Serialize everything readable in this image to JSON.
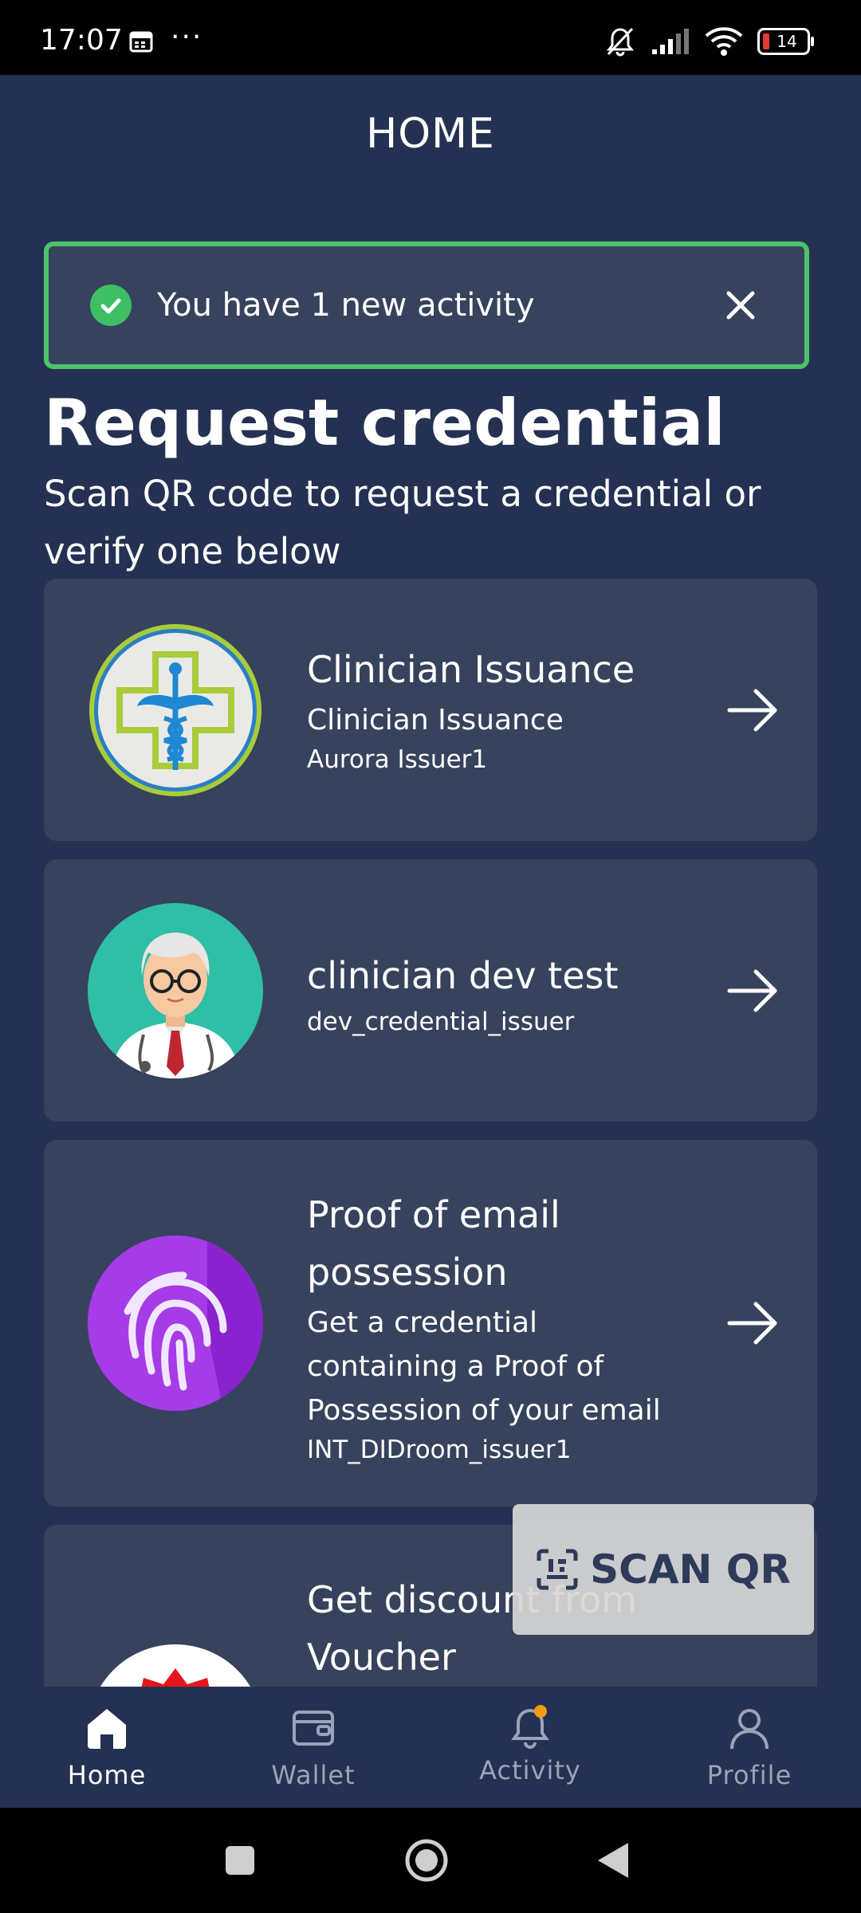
{
  "status_bar": {
    "time": "17:07",
    "overflow": "···",
    "battery_level": "14",
    "icons": [
      "calendar-icon",
      "mute-icon",
      "signal-icon",
      "wifi-icon",
      "battery-icon"
    ]
  },
  "header": {
    "title": "HOME"
  },
  "notification": {
    "text": "You have 1 new activity",
    "accent_color": "#4cc36a"
  },
  "section": {
    "title": "Request credential",
    "subtitle": "Scan QR code to request a credential or verify one below"
  },
  "credentials": [
    {
      "title": "Clinician Issuance",
      "subtitle": "Clinician Issuance",
      "issuer": "Aurora Issuer1",
      "icon": "medical-caduceus-icon"
    },
    {
      "title": "clinician dev test",
      "subtitle": "",
      "issuer": "dev_credential_issuer",
      "icon": "doctor-avatar-icon"
    },
    {
      "title": "Proof of email possession",
      "subtitle": "Get a credential containing a Proof of Possession of your email",
      "issuer": "INT_DIDroom_issuer1",
      "icon": "fingerprint-icon"
    },
    {
      "title": "Get discount from Voucher",
      "subtitle": "",
      "issuer": "",
      "icon": "voucher-badge-icon"
    }
  ],
  "scan_button": {
    "label": "SCAN QR"
  },
  "bottom_nav": {
    "items": [
      {
        "label": "Home",
        "active": true
      },
      {
        "label": "Wallet",
        "active": false
      },
      {
        "label": "Activity",
        "active": false,
        "badge_color": "#f39c12"
      },
      {
        "label": "Profile",
        "active": false
      }
    ]
  },
  "colors": {
    "background": "#243152",
    "card": "#37425c",
    "success": "#3fbf63"
  }
}
